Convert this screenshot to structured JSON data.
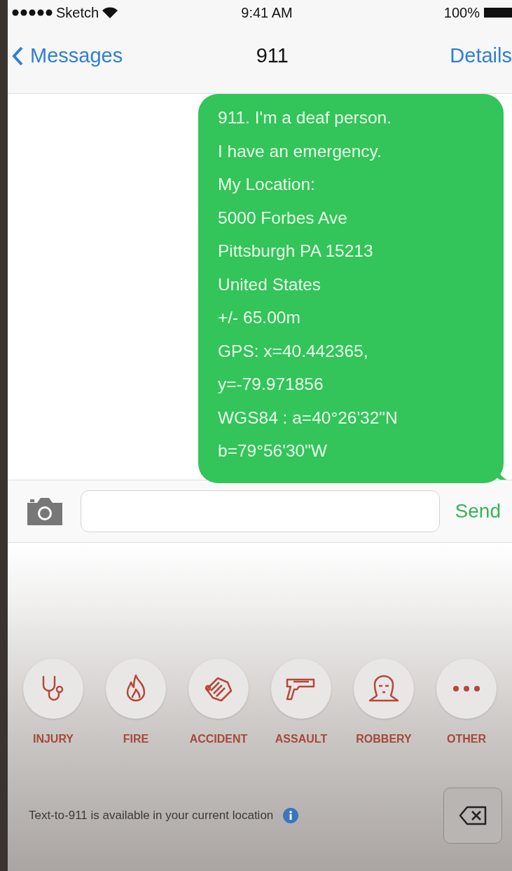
{
  "status_bar": {
    "carrier": "Sketch",
    "time": "9:41 AM",
    "battery": "100%"
  },
  "nav": {
    "back": "Messages",
    "title": "911",
    "action": "Details"
  },
  "message": {
    "lines": [
      "911. I'm a deaf person.",
      "I have an emergency.",
      "My Location:",
      "5000 Forbes Ave",
      "Pittsburgh PA 15213",
      "United States",
      "+/- 65.00m",
      "GPS: x=40.442365,",
      "y=-79.971856",
      "WGS84 : a=40°26'32\"N",
      "b=79°56'30\"W"
    ]
  },
  "composer": {
    "send": "Send"
  },
  "emergency_buttons": [
    {
      "kind": "injury",
      "label": "INJURY"
    },
    {
      "kind": "fire",
      "label": "FIRE"
    },
    {
      "kind": "accident",
      "label": "ACCIDENT"
    },
    {
      "kind": "assault",
      "label": "ASSAULT"
    },
    {
      "kind": "robbery",
      "label": "ROBBERY"
    },
    {
      "kind": "other",
      "label": "OTHER"
    }
  ],
  "notice": {
    "text": "Text-to-911 is available in your current location"
  }
}
